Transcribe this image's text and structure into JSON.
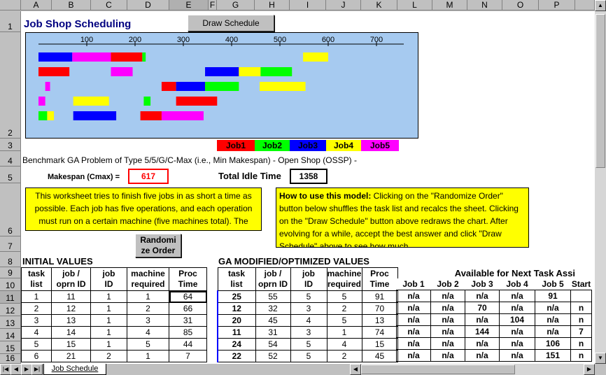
{
  "columns": [
    "A",
    "B",
    "C",
    "D",
    "E",
    "F",
    "G",
    "H",
    "I",
    "J",
    "K",
    "L",
    "M",
    "N",
    "O",
    "P"
  ],
  "rows": [
    "1",
    "2",
    "3",
    "4",
    "5",
    "6",
    "7",
    "8",
    "9",
    "10",
    "11",
    "12",
    "13",
    "14",
    "15",
    "16"
  ],
  "title": "Job Shop Scheduling",
  "draw_button": "Draw Schedule",
  "randomize_button_line1": "Randomi",
  "randomize_button_line2": "ze Order",
  "chart_data": {
    "type": "gantt",
    "x_ticks": [
      "100",
      "200",
      "300",
      "400",
      "500",
      "600",
      "700"
    ],
    "machines": 5,
    "colors": {
      "Job1": "#ff0000",
      "Job2": "#00ff00",
      "Job3": "#0000ff",
      "Job4": "#ffff00",
      "Job5": "#ff00ff"
    },
    "bars": [
      {
        "machine": 1,
        "job": "Job3",
        "start": 0,
        "end": 70
      },
      {
        "machine": 1,
        "job": "Job5",
        "start": 70,
        "end": 150
      },
      {
        "machine": 1,
        "job": "Job1",
        "start": 150,
        "end": 215
      },
      {
        "machine": 1,
        "job": "Job2",
        "start": 215,
        "end": 222
      },
      {
        "machine": 1,
        "job": "Job4",
        "start": 548,
        "end": 600
      },
      {
        "machine": 2,
        "job": "Job1",
        "start": 0,
        "end": 64
      },
      {
        "machine": 2,
        "job": "Job5",
        "start": 150,
        "end": 195
      },
      {
        "machine": 2,
        "job": "Job3",
        "start": 345,
        "end": 415
      },
      {
        "machine": 2,
        "job": "Job4",
        "start": 415,
        "end": 460
      },
      {
        "machine": 2,
        "job": "Job2",
        "start": 460,
        "end": 525
      },
      {
        "machine": 3,
        "job": "Job5",
        "start": 14,
        "end": 24
      },
      {
        "machine": 3,
        "job": "Job1",
        "start": 255,
        "end": 285
      },
      {
        "machine": 3,
        "job": "Job3",
        "start": 285,
        "end": 345
      },
      {
        "machine": 3,
        "job": "Job2",
        "start": 345,
        "end": 415
      },
      {
        "machine": 3,
        "job": "Job4",
        "start": 458,
        "end": 553
      },
      {
        "machine": 4,
        "job": "Job5",
        "start": 0,
        "end": 14
      },
      {
        "machine": 4,
        "job": "Job4",
        "start": 72,
        "end": 146
      },
      {
        "machine": 4,
        "job": "Job2",
        "start": 218,
        "end": 232
      },
      {
        "machine": 4,
        "job": "Job1",
        "start": 285,
        "end": 370
      },
      {
        "machine": 5,
        "job": "Job2",
        "start": 0,
        "end": 18
      },
      {
        "machine": 5,
        "job": "Job4",
        "start": 18,
        "end": 32
      },
      {
        "machine": 5,
        "job": "Job3",
        "start": 72,
        "end": 161
      },
      {
        "machine": 5,
        "job": "Job1",
        "start": 211,
        "end": 255
      },
      {
        "machine": 5,
        "job": "Job5",
        "start": 255,
        "end": 342
      }
    ]
  },
  "legend": [
    "Job1",
    "Job2",
    "Job3",
    "Job4",
    "Job5"
  ],
  "benchmark_text": "Benchmark GA Problem of Type 5/5/G/C-Max (i.e., Min Makespan) - Open Shop (OSSP) -",
  "makespan_label": "Makespan (Cmax) =",
  "makespan_value": "617",
  "idle_label": "Total Idle Time",
  "idle_value": "1358",
  "note_left": "This worksheet tries to finish five jobs in as short a time as possible. Each job has five operations, and each operation must run on a certain machine (five machines total). The \"Lexical\" method is used to find an order to the",
  "note_right_bold": "How to use this model:",
  "note_right": " Clicking on the \"Randomize Order\" button below shuffles the task list and recalcs the sheet. Clicking on the \"Draw Schedule\" button above redraws the chart. After evolving for a while, accept the best answer and click \"Draw Schedule\" above to see how much",
  "initial_title": "INITIAL VALUES",
  "ga_title": "GA MODIFIED/OPTIMIZED VALUES",
  "initial_headers": [
    [
      "task",
      "list"
    ],
    [
      "job /",
      "oprn ID"
    ],
    [
      "job",
      "ID"
    ],
    [
      "machine",
      "required"
    ],
    [
      "Proc",
      "Time"
    ]
  ],
  "ga_headers": [
    [
      "task",
      "list"
    ],
    [
      "job /",
      "oprn ID"
    ],
    [
      "job",
      "ID"
    ],
    [
      "machine",
      "required"
    ],
    [
      "Proc",
      "Time"
    ]
  ],
  "available_header": "Available for Next Task Assi",
  "avail_cols": [
    "Job 1",
    "Job 2",
    "Job 3",
    "Job 4",
    "Job 5",
    "Start"
  ],
  "initial_rows": [
    [
      "1",
      "11",
      "1",
      "1",
      "64"
    ],
    [
      "2",
      "12",
      "1",
      "2",
      "66"
    ],
    [
      "3",
      "13",
      "1",
      "3",
      "31"
    ],
    [
      "4",
      "14",
      "1",
      "4",
      "85"
    ],
    [
      "5",
      "15",
      "1",
      "5",
      "44"
    ],
    [
      "6",
      "21",
      "2",
      "1",
      "7"
    ]
  ],
  "ga_rows": [
    [
      "25",
      "55",
      "5",
      "5",
      "91"
    ],
    [
      "12",
      "32",
      "3",
      "2",
      "70"
    ],
    [
      "20",
      "45",
      "4",
      "5",
      "13"
    ],
    [
      "11",
      "31",
      "3",
      "1",
      "74"
    ],
    [
      "24",
      "54",
      "5",
      "4",
      "15"
    ],
    [
      "22",
      "52",
      "5",
      "2",
      "45"
    ]
  ],
  "avail_rows": [
    [
      "n/a",
      "n/a",
      "n/a",
      "n/a",
      "91",
      ""
    ],
    [
      "n/a",
      "n/a",
      "70",
      "n/a",
      "n/a",
      "n"
    ],
    [
      "n/a",
      "n/a",
      "n/a",
      "104",
      "n/a",
      "n"
    ],
    [
      "n/a",
      "n/a",
      "144",
      "n/a",
      "n/a",
      "7"
    ],
    [
      "n/a",
      "n/a",
      "n/a",
      "n/a",
      "106",
      "n"
    ],
    [
      "n/a",
      "n/a",
      "n/a",
      "n/a",
      "151",
      "n"
    ]
  ],
  "sheet_tab": "Job Schedule"
}
